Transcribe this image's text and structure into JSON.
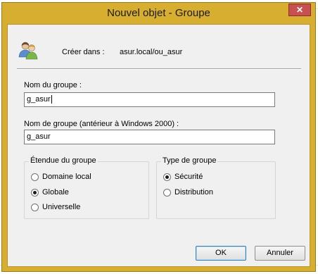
{
  "window": {
    "title": "Nouvel objet - Groupe",
    "close_glyph": "✕"
  },
  "header": {
    "icon": "users-icon",
    "create_in_label": "Créer dans :",
    "create_in_value": "asur.local/ou_asur"
  },
  "fields": {
    "group_name_label": "Nom du groupe :",
    "group_name_value": "g_asur",
    "group_name_pre2000_label": "Nom de groupe (antérieur à Windows 2000) :",
    "group_name_pre2000_value": "g_asur"
  },
  "scope": {
    "title": "Étendue du groupe",
    "options": [
      {
        "label": "Domaine local",
        "selected": false
      },
      {
        "label": "Globale",
        "selected": true
      },
      {
        "label": "Universelle",
        "selected": false
      }
    ]
  },
  "type": {
    "title": "Type de groupe",
    "options": [
      {
        "label": "Sécurité",
        "selected": true
      },
      {
        "label": "Distribution",
        "selected": false
      }
    ]
  },
  "buttons": {
    "ok": "OK",
    "cancel": "Annuler"
  },
  "colors": {
    "title_bar": "#d7ae2f",
    "close_button": "#c75050",
    "dialog_bg": "#f0f0f0"
  }
}
